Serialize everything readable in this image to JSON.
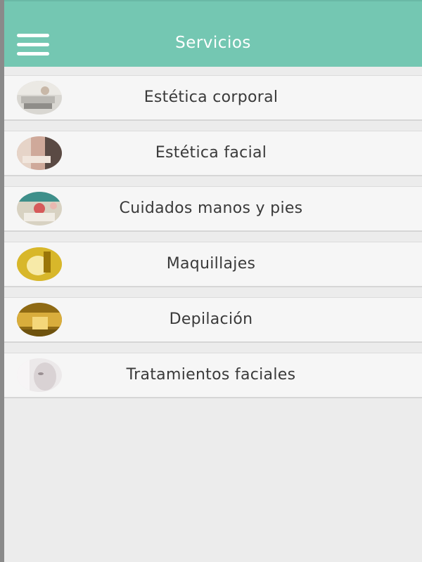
{
  "header": {
    "title": "Servicios",
    "menu_icon": "hamburger-menu-icon",
    "background": "#74c7b2"
  },
  "services": [
    {
      "label": "Estética corporal",
      "icon": "body-spa-thumbnail"
    },
    {
      "label": "Estética facial",
      "icon": "facial-room-thumbnail"
    },
    {
      "label": "Cuidados manos y pies",
      "icon": "manicure-thumbnail"
    },
    {
      "label": "Maquillajes",
      "icon": "gold-makeup-thumbnail"
    },
    {
      "label": "Depilación",
      "icon": "gold-wax-thumbnail"
    },
    {
      "label": "Tratamientos faciales",
      "icon": "face-treatment-thumbnail"
    }
  ]
}
